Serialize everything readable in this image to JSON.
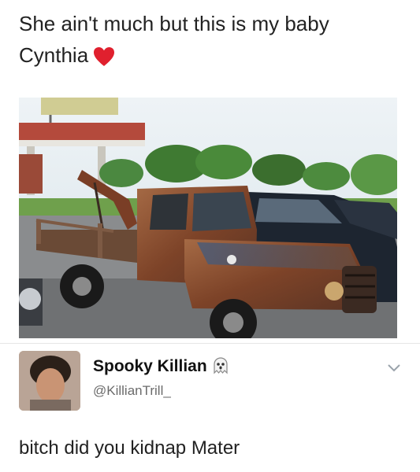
{
  "post": {
    "caption_line1": "She ain't much but this is my baby",
    "caption_line2": "Cynthia",
    "caption_icon": "red-heart-emoji"
  },
  "photo": {
    "subject": "rusty-tow-truck-photo"
  },
  "reply": {
    "display_name": "Spooky Killian",
    "name_icon": "ghost-emoji",
    "handle": "@KillianTrill_",
    "menu_icon": "chevron-down-icon",
    "text": "bitch did you kidnap Mater"
  },
  "colors": {
    "heart": "#e0202e",
    "truck_rust": "#8a4a2a",
    "sky": "#dfe9ee",
    "handle_gray": "#6b6b6b"
  }
}
